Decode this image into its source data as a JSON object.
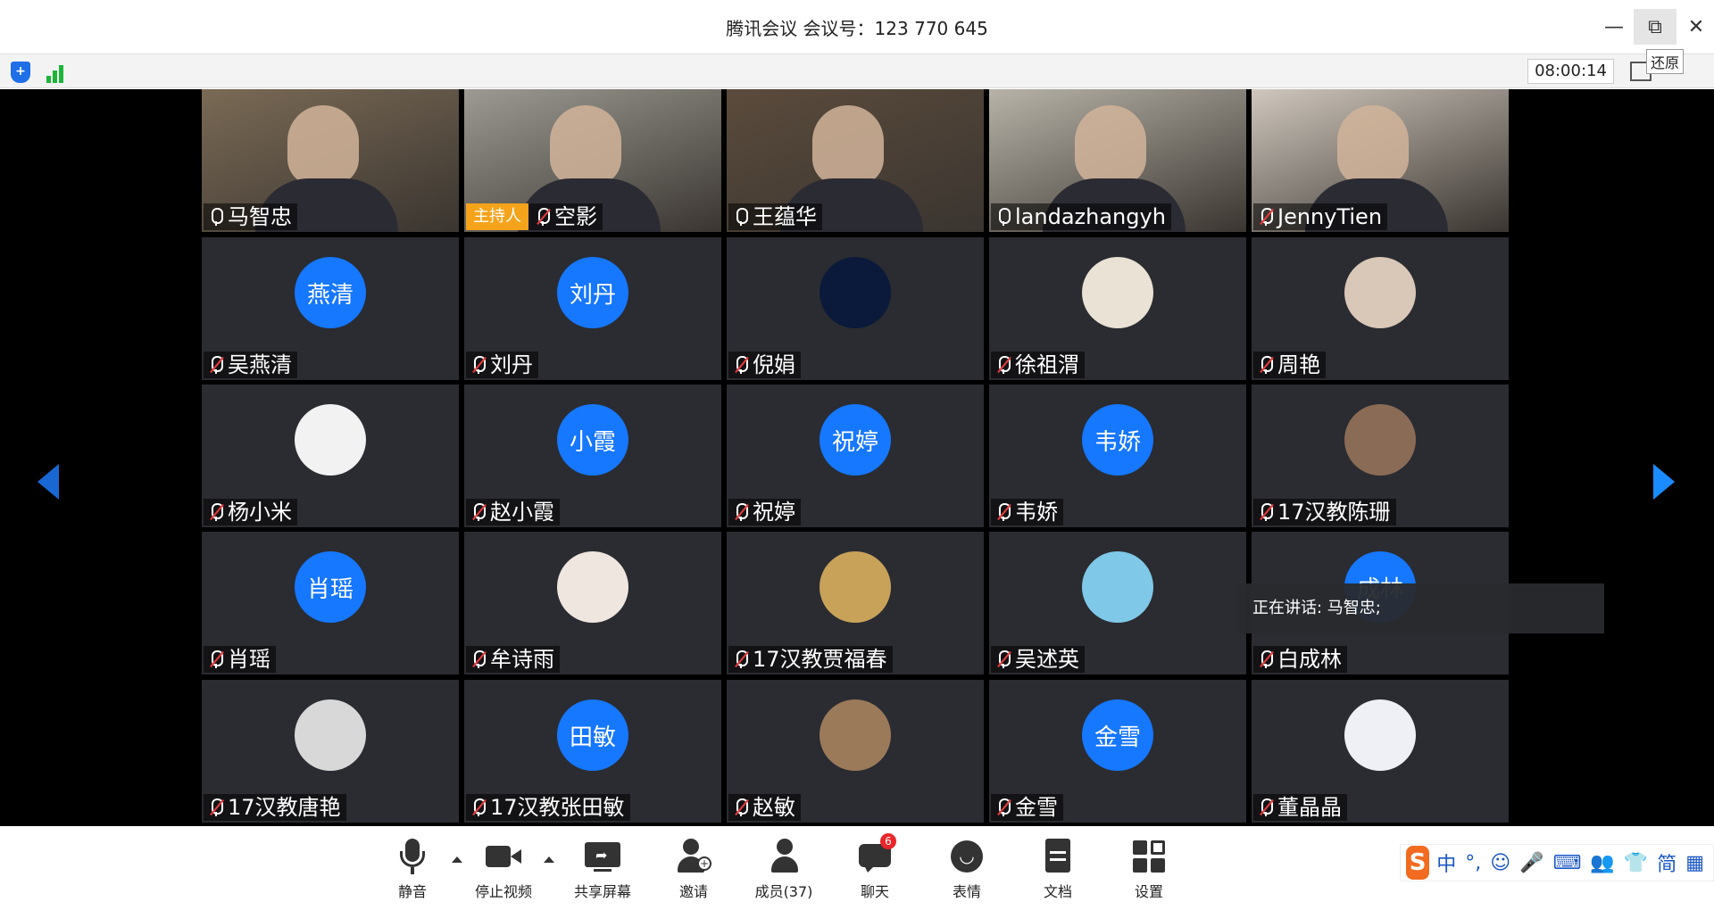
{
  "window": {
    "title": "腾讯会议 会议号：123 770 645",
    "minimize_label": "—",
    "restore_label": "⧉",
    "close_label": "✕",
    "tooltip": "还原"
  },
  "status": {
    "timer": "08:00:14",
    "signal_color": "#1bb53a",
    "security_icon": "shield-icon"
  },
  "participants": [
    {
      "name": "马智忠",
      "video": true,
      "muted": false,
      "bg": "#7a6a55"
    },
    {
      "name": "空影",
      "video": true,
      "muted": true,
      "host": true,
      "host_label": "主持人",
      "bg": "#9c9a93"
    },
    {
      "name": "王蕴华",
      "video": true,
      "muted": false,
      "bg": "#5b4b3c"
    },
    {
      "name": "landazhangyh",
      "video": true,
      "muted": false,
      "bg": "#b7b3a8"
    },
    {
      "name": "JennyTien",
      "video": true,
      "muted": true,
      "bg": "#cfc7bd"
    },
    {
      "name": "吴燕清",
      "avatar": "燕清",
      "muted": true
    },
    {
      "name": "刘丹",
      "avatar": "刘丹",
      "muted": true
    },
    {
      "name": "倪娟",
      "avatar_img": "#0b1a3a",
      "muted": true
    },
    {
      "name": "徐祖渭",
      "avatar_img": "#e9e2d5",
      "muted": true
    },
    {
      "name": "周艳",
      "avatar_img": "#d9c7b8",
      "muted": true
    },
    {
      "name": "杨小米",
      "avatar_img": "#f2f2f2",
      "muted": true
    },
    {
      "name": "赵小霞",
      "avatar": "小霞",
      "muted": true
    },
    {
      "name": "祝婷",
      "avatar": "祝婷",
      "muted": true
    },
    {
      "name": "韦娇",
      "avatar": "韦娇",
      "muted": true
    },
    {
      "name": "17汉教陈珊",
      "avatar_img": "#8a6b55",
      "muted": true
    },
    {
      "name": "肖瑶",
      "avatar": "肖瑶",
      "muted": true
    },
    {
      "name": "牟诗雨",
      "avatar_img": "#f0e6e0",
      "muted": true
    },
    {
      "name": "17汉教贾福春",
      "avatar_img": "#c9a25a",
      "muted": true
    },
    {
      "name": "吴述英",
      "avatar_img": "#7fc8e8",
      "muted": true
    },
    {
      "name": "白成林",
      "avatar": "成林",
      "muted": true
    },
    {
      "name": "17汉教唐艳",
      "avatar_img": "#d8d8d8",
      "muted": true
    },
    {
      "name": "17汉教张田敏",
      "avatar": "田敏",
      "muted": true
    },
    {
      "name": "赵敏",
      "avatar_img": "#9b7a5a",
      "muted": true
    },
    {
      "name": "金雪",
      "avatar": "金雪",
      "muted": true
    },
    {
      "name": "董晶晶",
      "avatar_img": "#eef0f5",
      "muted": true
    }
  ],
  "speaking": "正在讲话: 马智忠;",
  "toolbar": {
    "mute": "静音",
    "stop_video": "停止视频",
    "share": "共享屏幕",
    "invite": "邀请",
    "members": "成员(37)",
    "chat": "聊天",
    "chat_badge": "6",
    "emoji": "表情",
    "docs": "文档",
    "settings": "设置"
  },
  "ime": {
    "logo": "S",
    "items": [
      "中",
      "°,",
      "☺",
      "🎤",
      "⌨",
      "👥",
      "👕",
      "简",
      "▦"
    ]
  }
}
